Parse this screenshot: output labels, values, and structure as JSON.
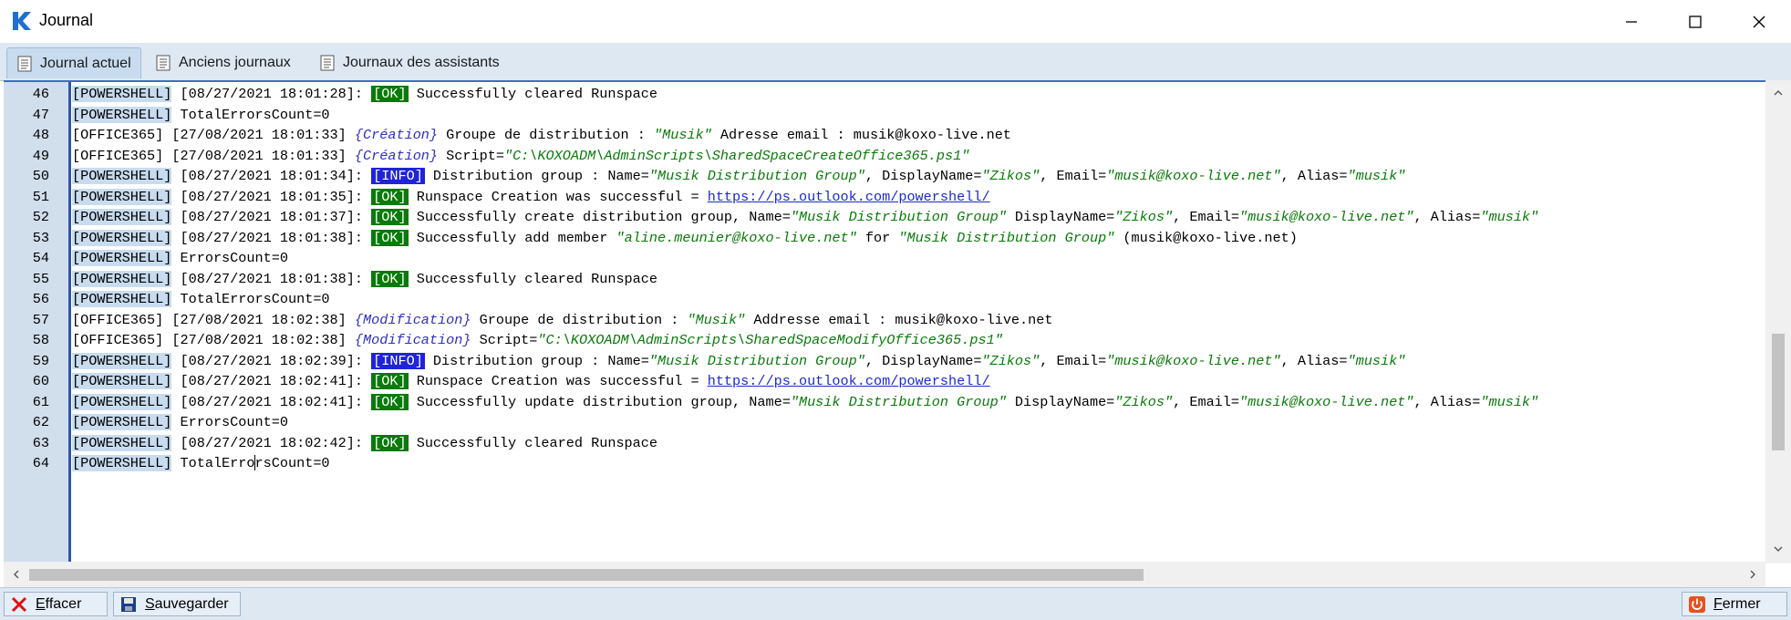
{
  "window": {
    "title": "Journal",
    "icon": "k-logo-icon",
    "accent": "#2f56a8"
  },
  "tabs": [
    {
      "label": "Journal actuel",
      "icon": "log-page-icon",
      "active": true
    },
    {
      "label": "Anciens journaux",
      "icon": "log-page-icon",
      "active": false
    },
    {
      "label": "Journaux des assistants",
      "icon": "log-page-icon",
      "active": false
    }
  ],
  "log_lines": [
    {
      "n": "46",
      "parts": [
        [
          "src",
          "[POWERSHELL]"
        ],
        [
          "t",
          " [08/27/2021 18:01:28]: "
        ],
        [
          "ok",
          "[OK]"
        ],
        [
          "t",
          " Successfully cleared Runspace"
        ]
      ]
    },
    {
      "n": "47",
      "parts": [
        [
          "src",
          "[POWERSHELL]"
        ],
        [
          "t",
          " TotalErrorsCount=0"
        ]
      ]
    },
    {
      "n": "48",
      "parts": [
        [
          "t",
          "[OFFICE365] [27/08/2021 18:01:33] "
        ],
        [
          "b",
          "{Création}"
        ],
        [
          "t",
          " Groupe de distribution : "
        ],
        [
          "g",
          "\"Musik\""
        ],
        [
          "t",
          " Adresse email : musik@koxo-live.net"
        ]
      ]
    },
    {
      "n": "49",
      "parts": [
        [
          "t",
          "[OFFICE365] [27/08/2021 18:01:33] "
        ],
        [
          "b",
          "{Création}"
        ],
        [
          "t",
          " Script="
        ],
        [
          "g",
          "\"C:\\KOXOADM\\AdminScripts\\SharedSpaceCreateOffice365.ps1\""
        ]
      ]
    },
    {
      "n": "50",
      "parts": [
        [
          "src",
          "[POWERSHELL]"
        ],
        [
          "t",
          " [08/27/2021 18:01:34]: "
        ],
        [
          "info",
          "[INFO]"
        ],
        [
          "t",
          " Distribution group : Name="
        ],
        [
          "g",
          "\"Musik Distribution Group\""
        ],
        [
          "t",
          ", DisplayName="
        ],
        [
          "g",
          "\"Zikos\""
        ],
        [
          "t",
          ", Email="
        ],
        [
          "g",
          "\"musik@koxo-live.net\""
        ],
        [
          "t",
          ", Alias="
        ],
        [
          "g",
          "\"musik\""
        ]
      ]
    },
    {
      "n": "51",
      "parts": [
        [
          "src",
          "[POWERSHELL]"
        ],
        [
          "t",
          " [08/27/2021 18:01:35]: "
        ],
        [
          "ok",
          "[OK]"
        ],
        [
          "t",
          " Runspace Creation was successful = "
        ],
        [
          "link",
          "https://ps.outlook.com/powershell/"
        ]
      ]
    },
    {
      "n": "52",
      "parts": [
        [
          "src",
          "[POWERSHELL]"
        ],
        [
          "t",
          " [08/27/2021 18:01:37]: "
        ],
        [
          "ok",
          "[OK]"
        ],
        [
          "t",
          " Successfully create distribution group, Name="
        ],
        [
          "g",
          "\"Musik Distribution Group\""
        ],
        [
          "t",
          " DisplayName="
        ],
        [
          "g",
          "\"Zikos\""
        ],
        [
          "t",
          ", Email="
        ],
        [
          "g",
          "\"musik@koxo-live.net\""
        ],
        [
          "t",
          ", Alias="
        ],
        [
          "g",
          "\"musik\""
        ]
      ]
    },
    {
      "n": "53",
      "parts": [
        [
          "src",
          "[POWERSHELL]"
        ],
        [
          "t",
          " [08/27/2021 18:01:38]: "
        ],
        [
          "ok",
          "[OK]"
        ],
        [
          "t",
          " Successfully add member "
        ],
        [
          "g",
          "\"aline.meunier@koxo-live.net\""
        ],
        [
          "t",
          " for "
        ],
        [
          "g",
          "\"Musik Distribution Group\""
        ],
        [
          "t",
          " (musik@koxo-live.net)"
        ]
      ]
    },
    {
      "n": "54",
      "parts": [
        [
          "src",
          "[POWERSHELL]"
        ],
        [
          "t",
          " ErrorsCount=0"
        ]
      ]
    },
    {
      "n": "55",
      "parts": [
        [
          "src",
          "[POWERSHELL]"
        ],
        [
          "t",
          " [08/27/2021 18:01:38]: "
        ],
        [
          "ok",
          "[OK]"
        ],
        [
          "t",
          " Successfully cleared Runspace"
        ]
      ]
    },
    {
      "n": "56",
      "parts": [
        [
          "src",
          "[POWERSHELL]"
        ],
        [
          "t",
          " TotalErrorsCount=0"
        ]
      ]
    },
    {
      "n": "57",
      "parts": [
        [
          "t",
          "[OFFICE365] [27/08/2021 18:02:38] "
        ],
        [
          "b",
          "{Modification}"
        ],
        [
          "t",
          " Groupe de distribution : "
        ],
        [
          "g",
          "\"Musik\""
        ],
        [
          "t",
          " Addresse email : musik@koxo-live.net"
        ]
      ]
    },
    {
      "n": "58",
      "parts": [
        [
          "t",
          "[OFFICE365] [27/08/2021 18:02:38] "
        ],
        [
          "b",
          "{Modification}"
        ],
        [
          "t",
          " Script="
        ],
        [
          "g",
          "\"C:\\KOXOADM\\AdminScripts\\SharedSpaceModifyOffice365.ps1\""
        ]
      ]
    },
    {
      "n": "59",
      "parts": [
        [
          "src",
          "[POWERSHELL]"
        ],
        [
          "t",
          " [08/27/2021 18:02:39]: "
        ],
        [
          "info",
          "[INFO]"
        ],
        [
          "t",
          " Distribution group : Name="
        ],
        [
          "g",
          "\"Musik Distribution Group\""
        ],
        [
          "t",
          ", DisplayName="
        ],
        [
          "g",
          "\"Zikos\""
        ],
        [
          "t",
          ", Email="
        ],
        [
          "g",
          "\"musik@koxo-live.net\""
        ],
        [
          "t",
          ", Alias="
        ],
        [
          "g",
          "\"musik\""
        ]
      ]
    },
    {
      "n": "60",
      "parts": [
        [
          "src",
          "[POWERSHELL]"
        ],
        [
          "t",
          " [08/27/2021 18:02:41]: "
        ],
        [
          "ok",
          "[OK]"
        ],
        [
          "t",
          " Runspace Creation was successful = "
        ],
        [
          "link",
          "https://ps.outlook.com/powershell/"
        ]
      ]
    },
    {
      "n": "61",
      "parts": [
        [
          "src",
          "[POWERSHELL]"
        ],
        [
          "t",
          " [08/27/2021 18:02:41]: "
        ],
        [
          "ok",
          "[OK]"
        ],
        [
          "t",
          " Successfully update distribution group, Name="
        ],
        [
          "g",
          "\"Musik Distribution Group\""
        ],
        [
          "t",
          " DisplayName="
        ],
        [
          "g",
          "\"Zikos\""
        ],
        [
          "t",
          ", Email="
        ],
        [
          "g",
          "\"musik@koxo-live.net\""
        ],
        [
          "t",
          ", Alias="
        ],
        [
          "g",
          "\"musik\""
        ]
      ]
    },
    {
      "n": "62",
      "parts": [
        [
          "src",
          "[POWERSHELL]"
        ],
        [
          "t",
          " ErrorsCount=0"
        ]
      ]
    },
    {
      "n": "63",
      "parts": [
        [
          "src",
          "[POWERSHELL]"
        ],
        [
          "t",
          " [08/27/2021 18:02:42]: "
        ],
        [
          "ok",
          "[OK]"
        ],
        [
          "t",
          " Successfully cleared Runspace"
        ]
      ]
    },
    {
      "n": "64",
      "parts": [
        [
          "src",
          "[POWERSHELL]"
        ],
        [
          "t",
          " TotalErro"
        ],
        [
          "caret",
          ""
        ],
        [
          "t",
          "rsCount=0"
        ]
      ]
    }
  ],
  "bottom": {
    "clear": {
      "pre": "E",
      "rest": "ffacer",
      "icon": "red-x-icon"
    },
    "save": {
      "pre": "S",
      "rest": "auvegarder",
      "icon": "floppy-disk-icon"
    },
    "close": {
      "pre": "F",
      "rest": "ermer",
      "icon": "power-icon"
    }
  },
  "colors": {
    "ok": "#0a7a0a",
    "info": "#1f24d8",
    "gutter": "#d1deec",
    "link": "#1a2ad2"
  }
}
